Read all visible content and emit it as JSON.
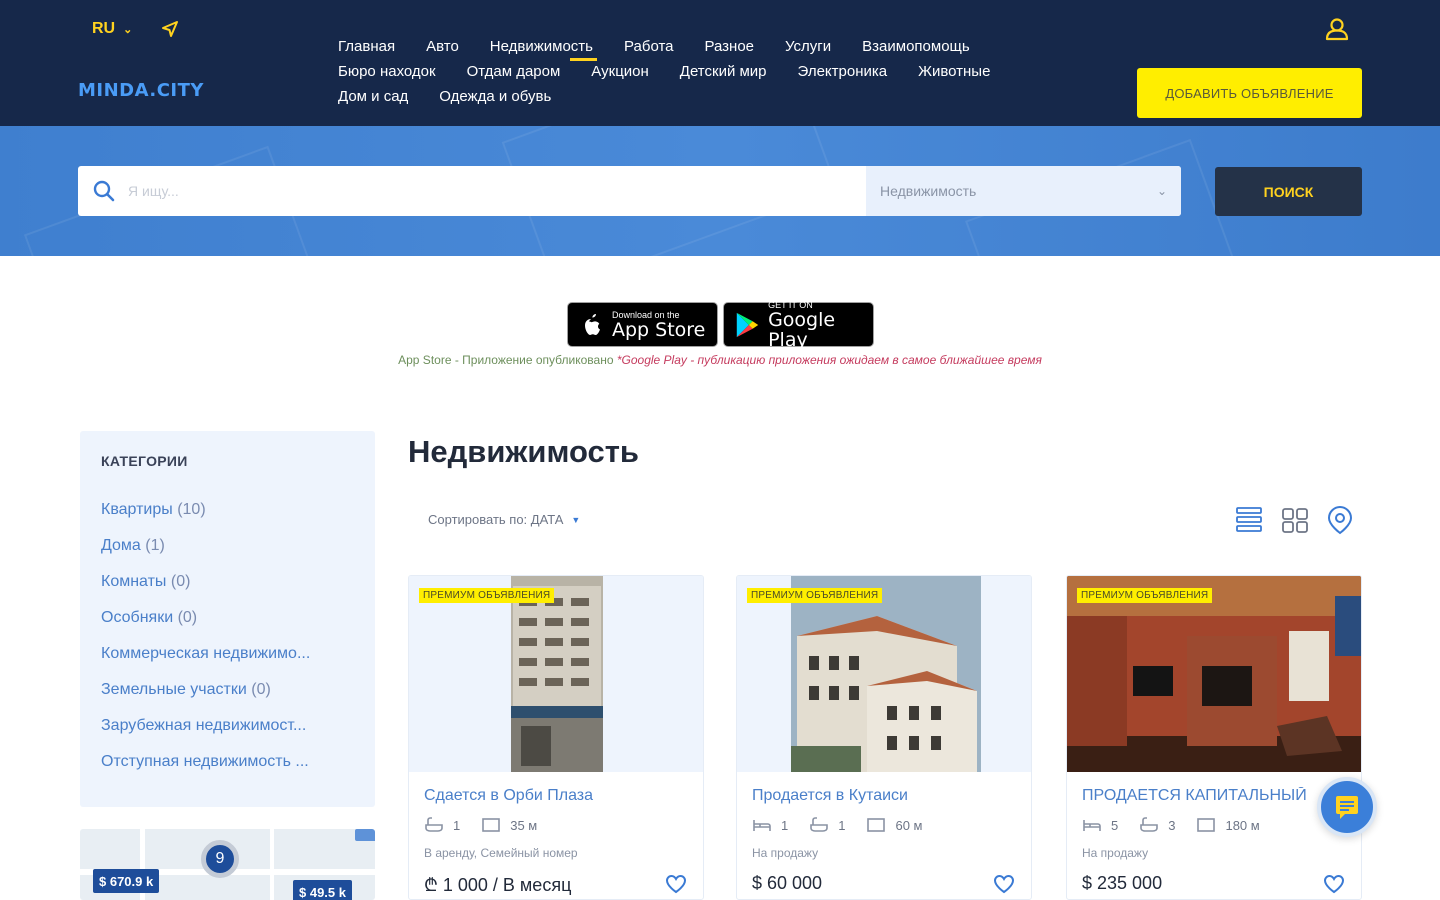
{
  "header": {
    "lang": "RU",
    "logo": "MINDA.CITY",
    "nav": [
      [
        "Главная",
        "Авто",
        "Недвижимость",
        "Работа",
        "Разное",
        "Услуги",
        "Взаимопомощь"
      ],
      [
        "Бюро находок",
        "Отдам даром",
        "Аукцион",
        "Детский мир",
        "Электроника",
        "Животные"
      ],
      [
        "Дом и сад",
        "Одежда и обувь"
      ]
    ],
    "active_nav": "Недвижимость",
    "add_button": "ДОБАВИТЬ ОБЪЯВЛЕНИЕ"
  },
  "search": {
    "placeholder": "Я ищу...",
    "category": "Недвижимость",
    "button": "ПОИСК"
  },
  "stores": {
    "apple_small": "Download on the",
    "apple_big": "App Store",
    "google_small": "GET IT ON",
    "google_big": "Google Play",
    "note_a": "App Store - Приложение опубликовано",
    "note_b": "*Google Play - публикацию приложения ожидаем в самое ближайшее время"
  },
  "sidebar": {
    "title": "КАТЕГОРИИ",
    "items": [
      {
        "label": "Квартиры",
        "count": "(10)"
      },
      {
        "label": "Дома",
        "count": "(1)"
      },
      {
        "label": "Комнаты",
        "count": "(0)"
      },
      {
        "label": "Особняки",
        "count": "(0)"
      },
      {
        "label": "Коммерческая недвижимо...",
        "count": ""
      },
      {
        "label": "Земельные участки",
        "count": "(0)"
      },
      {
        "label": "Зарубежная недвижимост...",
        "count": ""
      },
      {
        "label": "Отступная недвижимость ...",
        "count": ""
      }
    ],
    "map": {
      "cluster": "9",
      "price_1": "$ 670.9 k",
      "price_2": "$ 49.5 k"
    }
  },
  "main": {
    "title": "Недвижимость",
    "sort": "Сортировать по: ДАТА",
    "cards": [
      {
        "badge": "ПРЕМИУМ ОБЪЯВЛЕНИЯ",
        "title": "Сдается в Орби Плаза",
        "feat_1": "1",
        "feat_2": "35 м",
        "sub": "В аренду, Семейный номер",
        "price": "₾ 1 000 / В месяц"
      },
      {
        "badge": "ПРЕМИУМ ОБЪЯВЛЕНИЯ",
        "title": "Продается в Кутаиси",
        "feat_1": "1",
        "feat_2": "1",
        "feat_3": "60 м",
        "sub": "На продажу",
        "price": "$ 60 000"
      },
      {
        "badge": "ПРЕМИУМ ОБЪЯВЛЕНИЯ",
        "title": "ПРОДАЕТСЯ КАПИТАЛЬНЫЙ",
        "feat_1": "5",
        "feat_2": "3",
        "feat_3": "180 м",
        "sub": "На продажу",
        "price": "$ 235 000"
      }
    ]
  },
  "colors": {
    "header_bg": "#16284a",
    "accent_yellow": "#ffee00",
    "band_blue": "#4a8ad8",
    "link_blue": "#4a7fc9"
  },
  "icons": [
    "chevron-down-icon",
    "send-icon",
    "user-icon",
    "search-icon",
    "apple-icon",
    "google-play-icon",
    "list-view-icon",
    "grid-view-icon",
    "map-pin-icon",
    "bed-icon",
    "bath-icon",
    "area-icon",
    "heart-icon",
    "chat-icon"
  ]
}
